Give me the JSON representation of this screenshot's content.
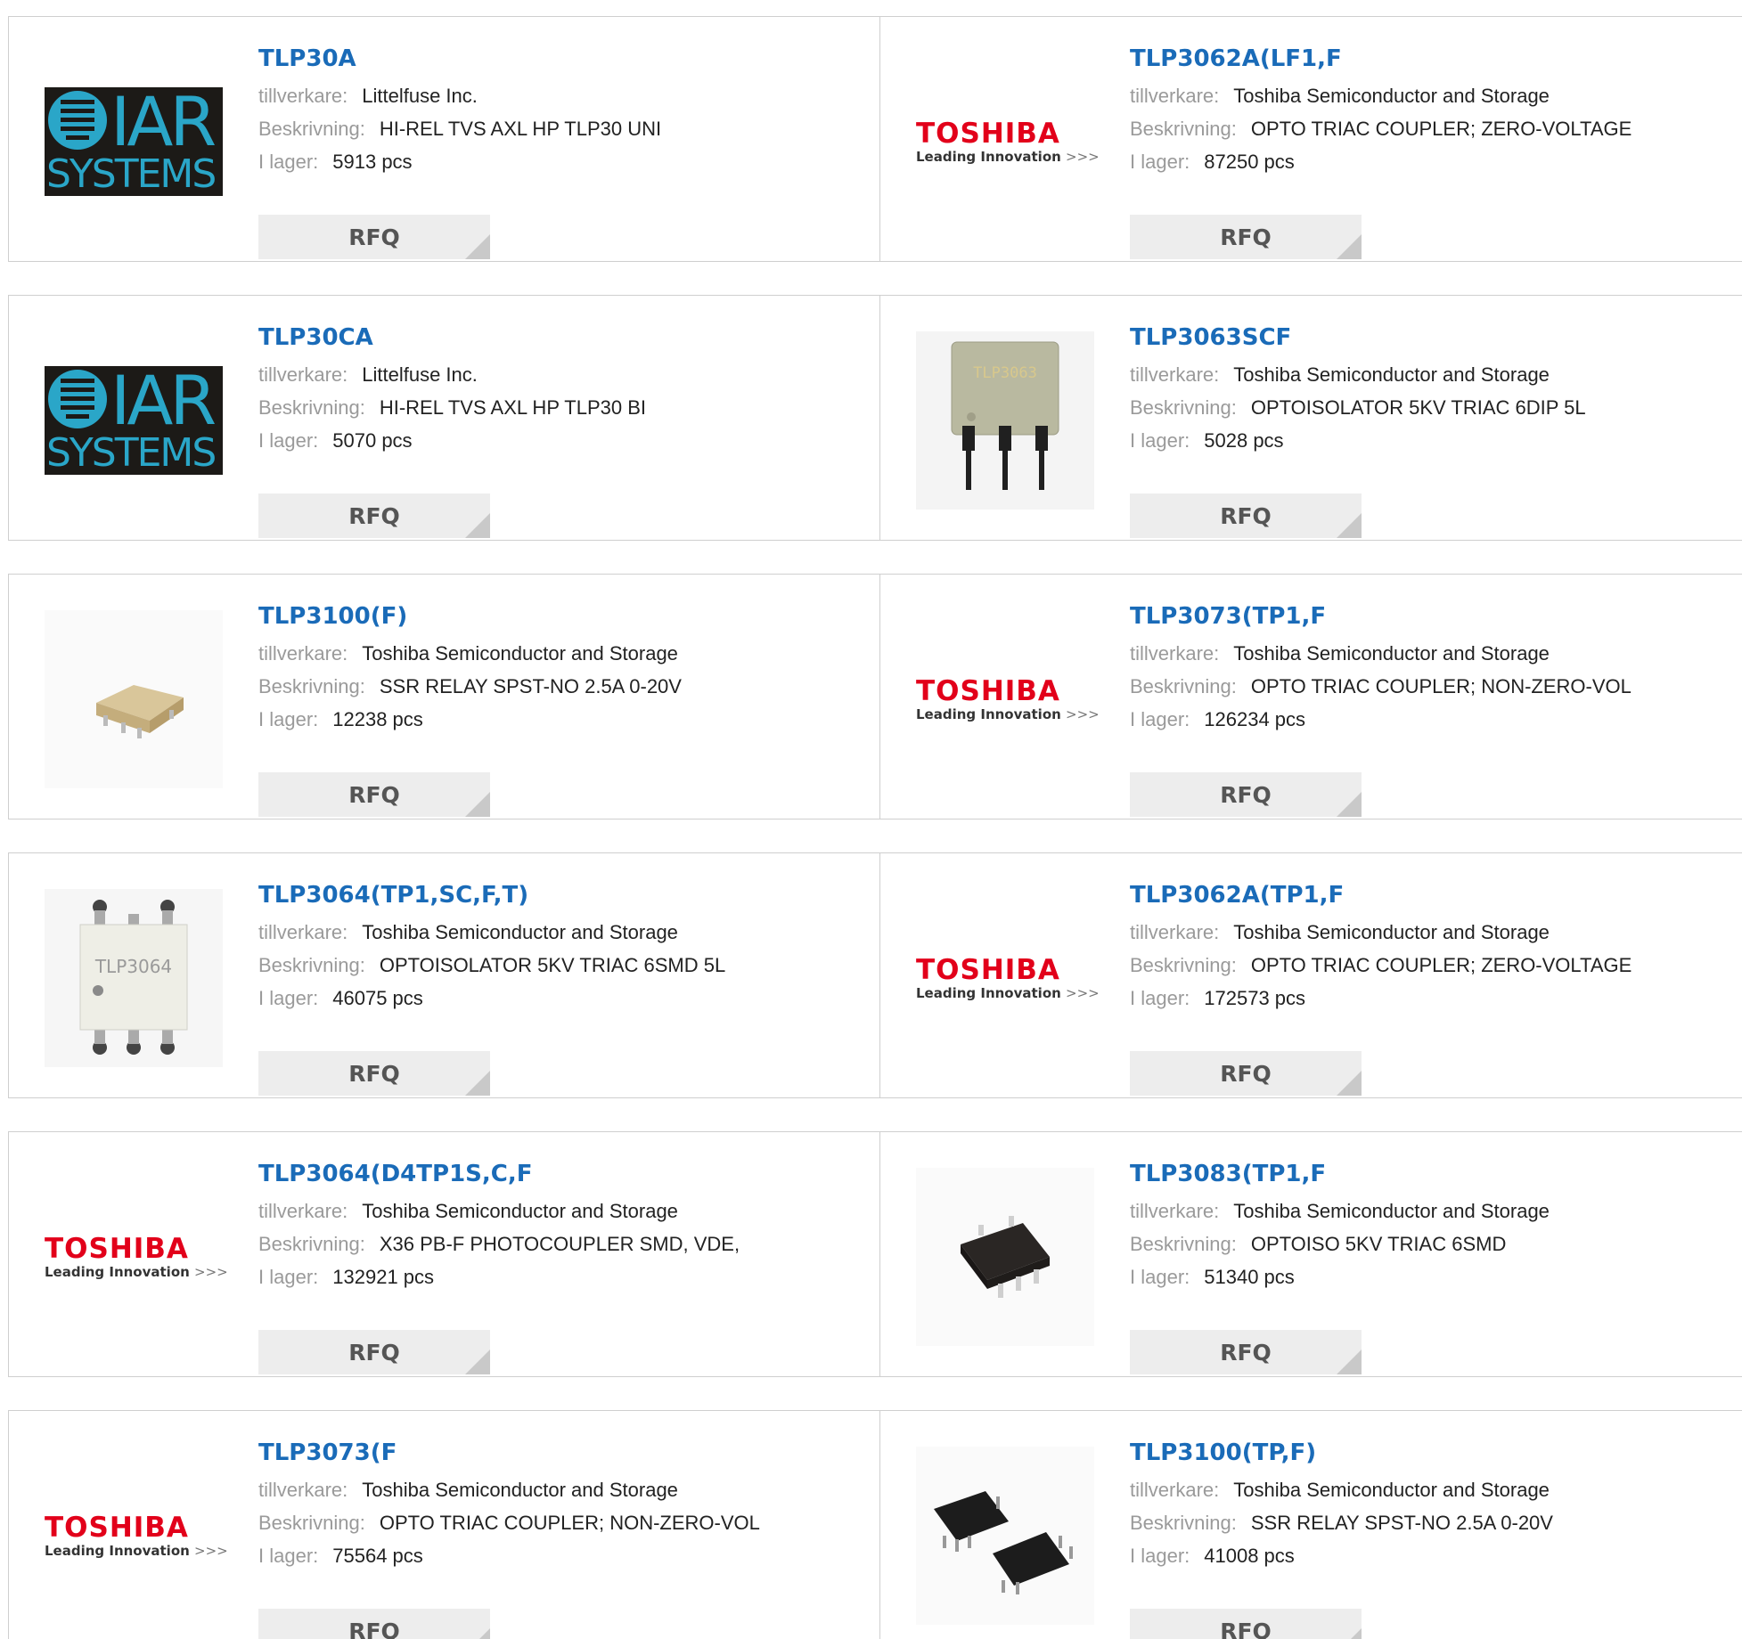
{
  "labels": {
    "manufacturer": "tillverkare:",
    "description": "Beskrivning:",
    "stock": "I lager:",
    "rfq": "RFQ"
  },
  "brands": {
    "iar_top": "IAR",
    "iar_bottom": "SYSTEMS",
    "toshiba": "TOSHIBA",
    "toshiba_tagline": "Leading Innovation",
    "toshiba_arrows": ">>>"
  },
  "products": [
    {
      "part": "TLP30A",
      "manufacturer": "Littelfuse Inc.",
      "description": "HI-REL TVS AXL HP TLP30 UNI",
      "stock": "5913 pcs",
      "image": "iar-logo"
    },
    {
      "part": "TLP3062A(LF1,F",
      "manufacturer": "Toshiba Semiconductor and Storage",
      "description": "OPTO TRIAC COUPLER; ZERO-VOLTAGE",
      "stock": "87250 pcs",
      "image": "toshiba-logo"
    },
    {
      "part": "TLP30CA",
      "manufacturer": "Littelfuse Inc.",
      "description": "HI-REL TVS AXL HP TLP30 BI",
      "stock": "5070 pcs",
      "image": "iar-logo"
    },
    {
      "part": "TLP3063SCF",
      "manufacturer": "Toshiba Semiconductor and Storage",
      "description": "OPTOISOLATOR 5KV TRIAC 6DIP 5L",
      "stock": "5028 pcs",
      "image": "dip-chip",
      "chip_text": "TLP3063"
    },
    {
      "part": "TLP3100(F)",
      "manufacturer": "Toshiba Semiconductor and Storage",
      "description": "SSR RELAY SPST-NO 2.5A 0-20V",
      "stock": "12238 pcs",
      "image": "small-smd-chip"
    },
    {
      "part": "TLP3073(TP1,F",
      "manufacturer": "Toshiba Semiconductor and Storage",
      "description": "OPTO TRIAC COUPLER; NON-ZERO-VOL",
      "stock": "126234 pcs",
      "image": "toshiba-logo"
    },
    {
      "part": "TLP3064(TP1,SC,F,T)",
      "manufacturer": "Toshiba Semiconductor and Storage",
      "description": "OPTOISOLATOR 5KV TRIAC 6SMD 5L",
      "stock": "46075 pcs",
      "image": "white-smd-chip",
      "chip_text": "TLP3064"
    },
    {
      "part": "TLP3062A(TP1,F",
      "manufacturer": "Toshiba Semiconductor and Storage",
      "description": "OPTO TRIAC COUPLER; ZERO-VOLTAGE",
      "stock": "172573 pcs",
      "image": "toshiba-logo"
    },
    {
      "part": "TLP3064(D4TP1S,C,F",
      "manufacturer": "Toshiba Semiconductor and Storage",
      "description": "X36 PB-F PHOTOCOUPLER SMD, VDE,",
      "stock": "132921 pcs",
      "image": "toshiba-logo"
    },
    {
      "part": "TLP3083(TP1,F",
      "manufacturer": "Toshiba Semiconductor and Storage",
      "description": "OPTOISO 5KV TRIAC 6SMD",
      "stock": "51340 pcs",
      "image": "black-smd-chip"
    },
    {
      "part": "TLP3073(F",
      "manufacturer": "Toshiba Semiconductor and Storage",
      "description": "OPTO TRIAC COUPLER; NON-ZERO-VOL",
      "stock": "75564 pcs",
      "image": "toshiba-logo"
    },
    {
      "part": "TLP3100(TP,F)",
      "manufacturer": "Toshiba Semiconductor and Storage",
      "description": "SSR RELAY SPST-NO 2.5A 0-20V",
      "stock": "41008 pcs",
      "image": "two-black-chips"
    }
  ],
  "colors": {
    "part_link": "#1a6bb8",
    "toshiba_red": "#e2001a",
    "iar_blue": "#2aa6c8",
    "rfq_bg": "#ededed"
  }
}
